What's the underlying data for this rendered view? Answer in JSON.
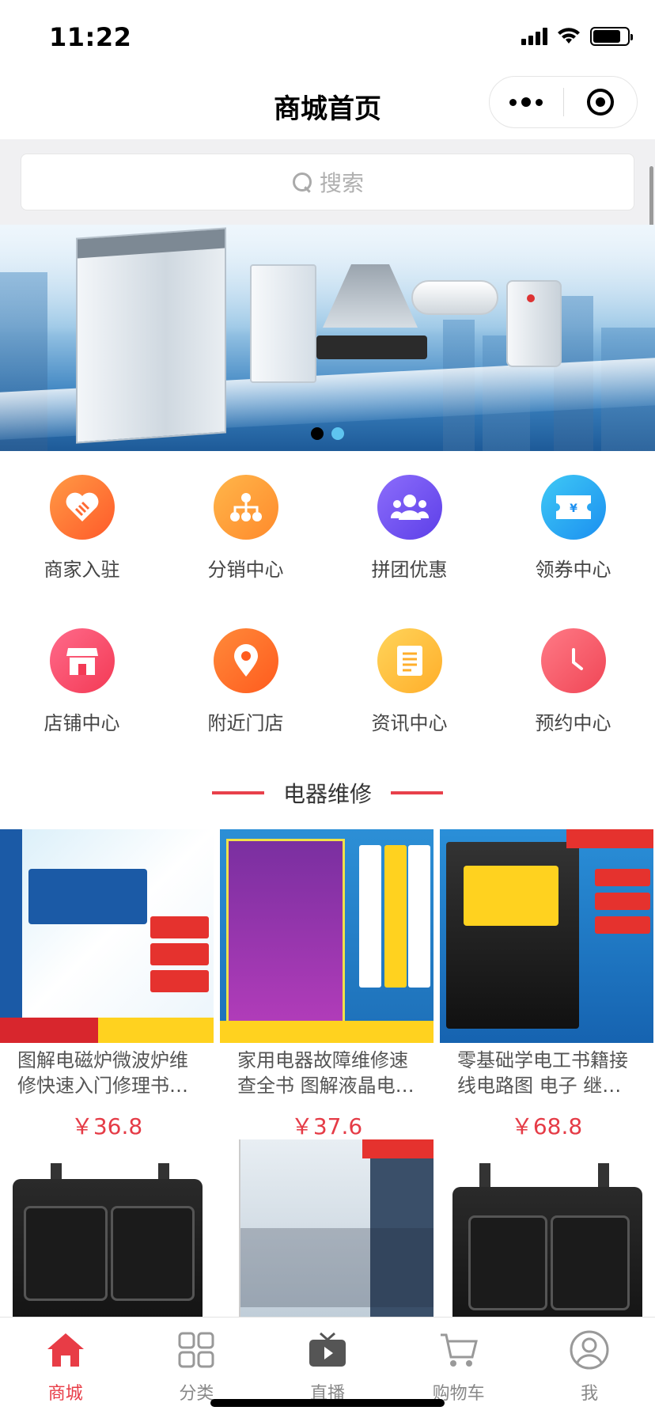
{
  "status_bar": {
    "time": "11:22",
    "battery_level": 0.8
  },
  "nav": {
    "title": "商城首页"
  },
  "search": {
    "placeholder": "搜索"
  },
  "banner": {
    "dots": 2,
    "active_dot": 1
  },
  "shortcuts": [
    {
      "label": "商家入驻",
      "icon": "handshake-icon",
      "color_from": "#ff9a45",
      "color_to": "#ff5a2a"
    },
    {
      "label": "分销中心",
      "icon": "network-icon",
      "color_from": "#ffb64a",
      "color_to": "#ff8a2c"
    },
    {
      "label": "拼团优惠",
      "icon": "group-icon",
      "color_from": "#8c6dfb",
      "color_to": "#5d3fe8"
    },
    {
      "label": "领券中心",
      "icon": "coupon-icon",
      "color_from": "#3fc9f5",
      "color_to": "#1b8ff0"
    },
    {
      "label": "店铺中心",
      "icon": "store-icon",
      "color_from": "#ff6a8a",
      "color_to": "#f33a55"
    },
    {
      "label": "附近门店",
      "icon": "location-icon",
      "color_from": "#ff8a3a",
      "color_to": "#ff5b1e"
    },
    {
      "label": "资讯中心",
      "icon": "news-icon",
      "color_from": "#ffd45a",
      "color_to": "#ffae2a"
    },
    {
      "label": "预约中心",
      "icon": "clock-icon",
      "color_from": "#ff7a86",
      "color_to": "#f04656"
    }
  ],
  "section": {
    "title": "电器维修"
  },
  "products": [
    {
      "name": "图解电磁炉微波炉维修快速入门修理书…",
      "price": "￥36.8"
    },
    {
      "name": "家用电器故障维修速查全书 图解液晶电…",
      "price": "￥37.6"
    },
    {
      "name": "零基础学电工书籍接线电路图 电子 继…",
      "price": "￥68.8"
    }
  ],
  "tabbar": [
    {
      "label": "商城",
      "icon": "home-icon",
      "active": true
    },
    {
      "label": "分类",
      "icon": "grid-icon",
      "active": false
    },
    {
      "label": "直播",
      "icon": "tv-icon",
      "active": false
    },
    {
      "label": "购物车",
      "icon": "cart-icon",
      "active": false
    },
    {
      "label": "我",
      "icon": "user-icon",
      "active": false
    }
  ],
  "colors": {
    "accent": "#e83c46",
    "price": "#e53b46"
  }
}
